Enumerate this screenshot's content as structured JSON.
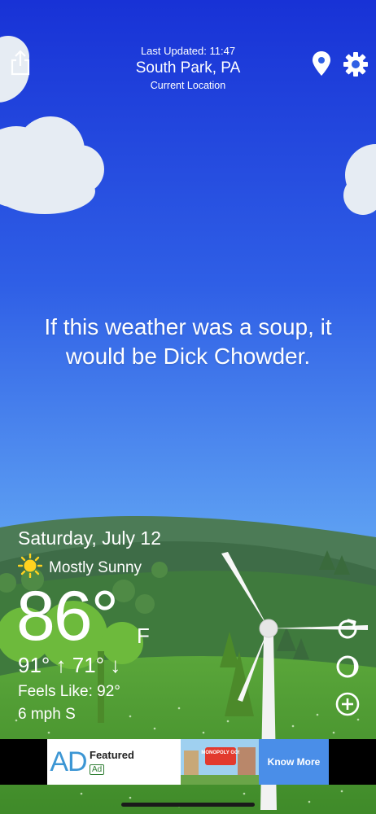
{
  "header": {
    "last_updated": "Last Updated: 11:47",
    "city": "South Park, PA",
    "location_label": "Current Location"
  },
  "icons": {
    "share": "share-icon",
    "location": "location-pin-icon",
    "settings": "gear-icon",
    "refresh": "refresh-icon",
    "dark_mode": "moon-icon",
    "zoom": "zoom-plus-icon",
    "condition": "sun-icon"
  },
  "quote": "If this weather was a soup, it would be Dick Chowder.",
  "weather": {
    "date": "Saturday, July 12",
    "condition": "Mostly Sunny",
    "temperature": "86°",
    "unit": "F",
    "high_low": "91° ↑ 71° ↓",
    "feels_like": "Feels Like: 92°",
    "wind": "6 mph S"
  },
  "ad": {
    "logo": "AD",
    "title": "Featured",
    "badge": "Ad",
    "game_label": "MONOPOLY GO!",
    "cta": "Know More"
  },
  "colors": {
    "sky_top": "#1832d6",
    "sky_bottom": "#6aaef5",
    "hill_far": "#4a7d55",
    "grass": "#4e9a33",
    "sun": "#ffd21f",
    "ad_button": "#4a8ee8",
    "ad_logo": "#3c96d4"
  }
}
